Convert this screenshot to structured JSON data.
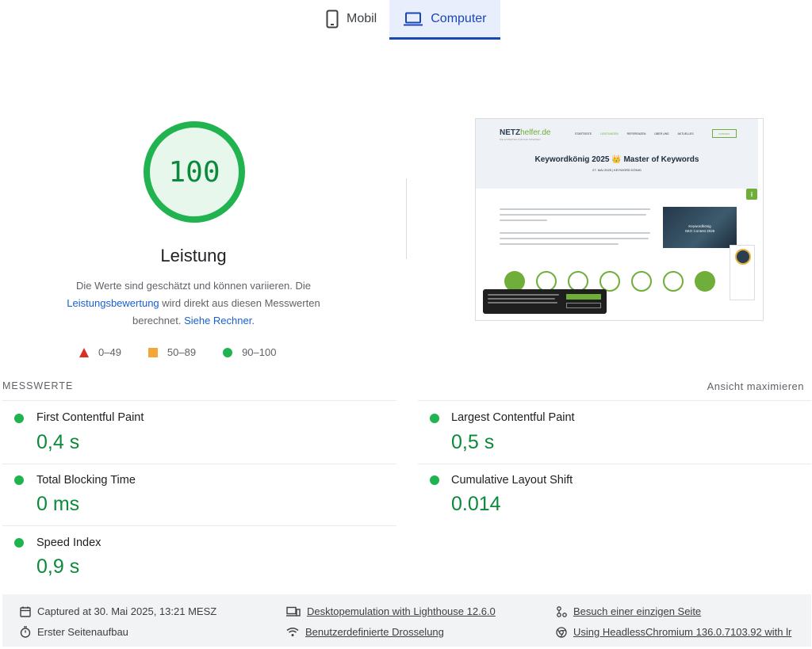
{
  "tabs": [
    {
      "label": "Mobil",
      "icon": "phone-icon",
      "active": false
    },
    {
      "label": "Computer",
      "icon": "laptop-icon",
      "active": true
    }
  ],
  "score": {
    "value": "100",
    "ratio": 1.0,
    "title": "Leistung",
    "color": "#0c8a3c"
  },
  "description": {
    "part1": "Die Werte sind geschätzt und können variieren. Die",
    "link1": "Leistungsbewertung",
    "part2": " wird direkt aus diesen Messwerten berechnet. ",
    "link2": "Siehe Rechner."
  },
  "legend": [
    {
      "shape": "triangle",
      "label": "0–49",
      "color": "#d93025"
    },
    {
      "shape": "square",
      "label": "50–89",
      "color": "#f4a738"
    },
    {
      "shape": "circle",
      "label": "90–100",
      "color": "#21b34f"
    }
  ],
  "screenshot": {
    "logo_main": "NETZ",
    "logo_accent": "helfer.de",
    "logo_sub": "DIE EXPERTEN FÜR DAS INTERNET",
    "nav": [
      "STARTSEITE",
      "LEISTUNGEN",
      "REFERENZEN",
      "ÜBER UNS",
      "AKTUELLES"
    ],
    "cta": "KONTAKT",
    "title": "Keywordkönig 2025 👑 Master of Keywords",
    "date": "27. MAI 2025 | KEYWORD KÖNIG",
    "badge": "i",
    "image_text_1": "Keywordkönig",
    "image_text_2": "SEO Contest 2025"
  },
  "metrics": {
    "heading": "MESSWERTE",
    "expand_label": "Ansicht maximieren",
    "items": [
      {
        "label": "First Contentful Paint",
        "value": "0,4 s"
      },
      {
        "label": "Largest Contentful Paint",
        "value": "0,5 s"
      },
      {
        "label": "Total Blocking Time",
        "value": "0 ms"
      },
      {
        "label": "Cumulative Layout Shift",
        "value": "0.014"
      },
      {
        "label": "Speed Index",
        "value": "0,9 s"
      }
    ]
  },
  "footer": {
    "captured": "Captured at 30. Mai 2025, 13:21 MESZ",
    "emulation": "Desktopemulation with Lighthouse 12.6.0",
    "session": "Besuch einer einzigen Seite",
    "load": "Erster Seitenaufbau",
    "throttling": "Benutzerdefinierte Drosselung",
    "browser": "Using HeadlessChromium 136.0.7103.92 with lr"
  }
}
